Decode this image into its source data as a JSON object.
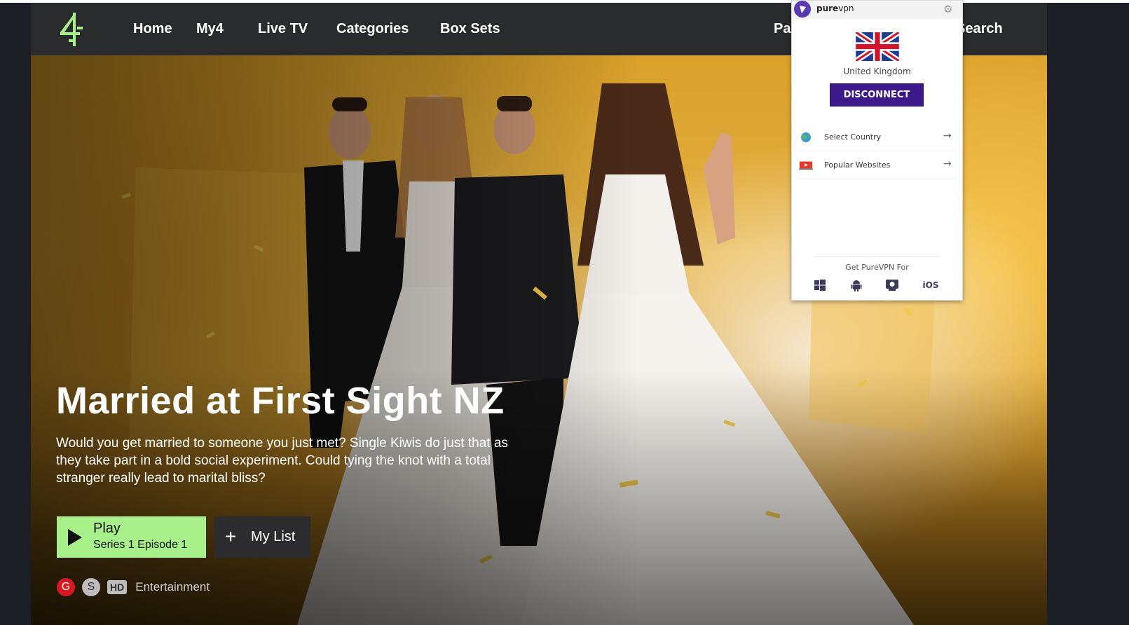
{
  "header": {
    "logo_name": "channel-4-logo",
    "nav": [
      "Home",
      "My4",
      "Live TV",
      "Categories",
      "Box Sets",
      "Pa"
    ],
    "search_label": "Search"
  },
  "hero": {
    "title": "Married at First Sight NZ",
    "description": "Would you get married to someone you just met? Single Kiwis do just that as they take part in a bold social experiment. Could tying the knot with a total stranger really lead to marital bliss?",
    "play_label": "Play",
    "play_sub": "Series 1 Episode 1",
    "mylist_label": "My List",
    "badges": {
      "g": "G",
      "s": "S",
      "hd": "HD"
    },
    "genre": "Entertainment"
  },
  "vpn": {
    "brand_pure": "pure",
    "brand_vpn": "vpn",
    "country": "United Kingdom",
    "disconnect": "DISCONNECT",
    "rows": [
      {
        "label": "Select Country",
        "icon": "globe-icon"
      },
      {
        "label": "Popular Websites",
        "icon": "video-site-icon"
      }
    ],
    "get_for": "Get PureVPN For",
    "platforms": [
      "windows-icon",
      "android-icon",
      "mac-icon",
      "iOS"
    ]
  },
  "colors": {
    "header_bg": "#2a2b2d",
    "play_green": "#a8f08a",
    "vpn_purple": "#3d1a8c",
    "logo_green": "#a8f08a",
    "rating_red": "#d71920"
  }
}
